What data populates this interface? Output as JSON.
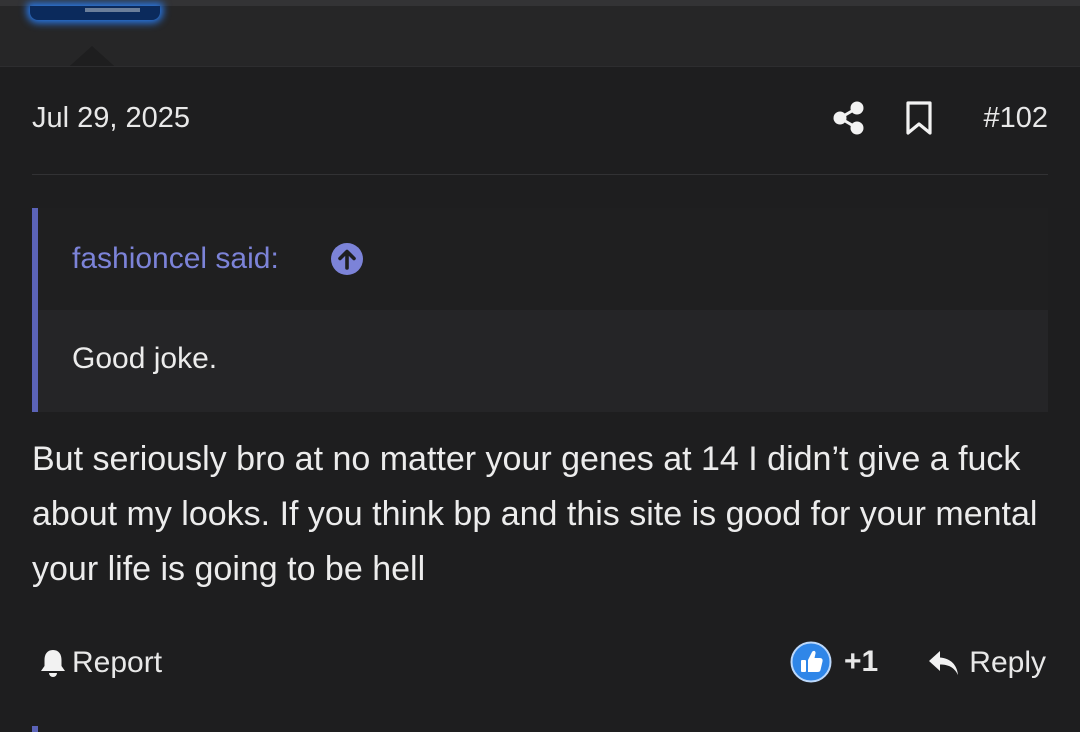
{
  "post": {
    "date": "Jul 29, 2025",
    "number": "#102",
    "body": "But seriously bro at no matter your genes at 14 I didn’t give a fuck about my looks. If you think bp and this site is good for your mental your life is going to be hell"
  },
  "quote": {
    "author": "fashioncel said:",
    "text": "Good joke."
  },
  "actions": {
    "report_label": "Report",
    "reaction_count": "+1",
    "reply_label": "Reply"
  },
  "icons": {
    "share": "share-icon",
    "bookmark": "bookmark-icon",
    "quote_jump": "arrow-up-circle-icon",
    "report": "bell-icon",
    "like": "thumbs-up-icon",
    "reply": "reply-arrow-icon"
  },
  "colors": {
    "background": "#1e1e1f",
    "quote_accent": "#5b63b7",
    "quote_author": "#7c83d8",
    "like_badge": "#2f86e8"
  }
}
